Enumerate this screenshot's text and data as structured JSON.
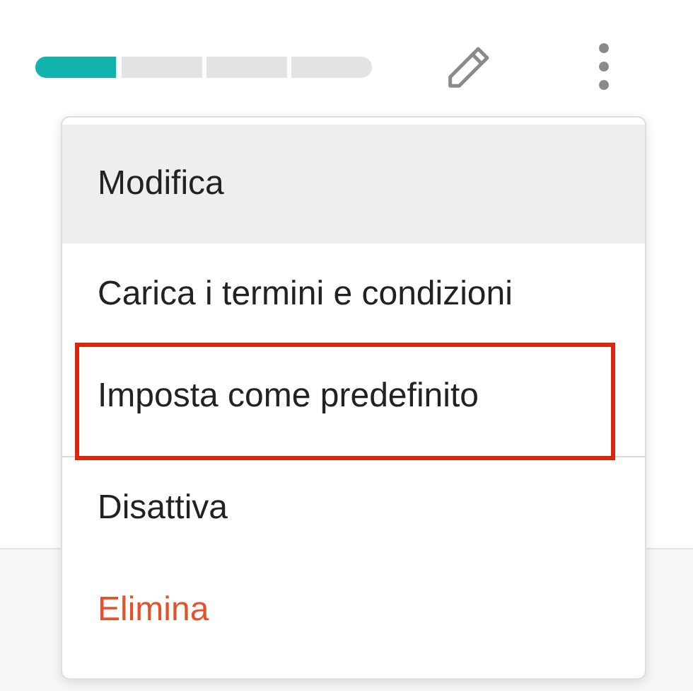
{
  "progress": {
    "level": 0.24
  },
  "menu": {
    "items": [
      {
        "label": "Modifica",
        "kind": "normal",
        "hovered": true,
        "highlighted": false,
        "divider_before": false
      },
      {
        "label": "Carica i termini e condizioni",
        "kind": "normal",
        "hovered": false,
        "highlighted": false,
        "divider_before": false
      },
      {
        "label": "Imposta come predefinito",
        "kind": "normal",
        "hovered": false,
        "highlighted": true,
        "divider_before": false
      },
      {
        "label": "Disattiva",
        "kind": "normal",
        "hovered": false,
        "highlighted": false,
        "divider_before": true
      },
      {
        "label": "Elimina",
        "kind": "danger",
        "hovered": false,
        "highlighted": false,
        "divider_before": false
      }
    ]
  }
}
